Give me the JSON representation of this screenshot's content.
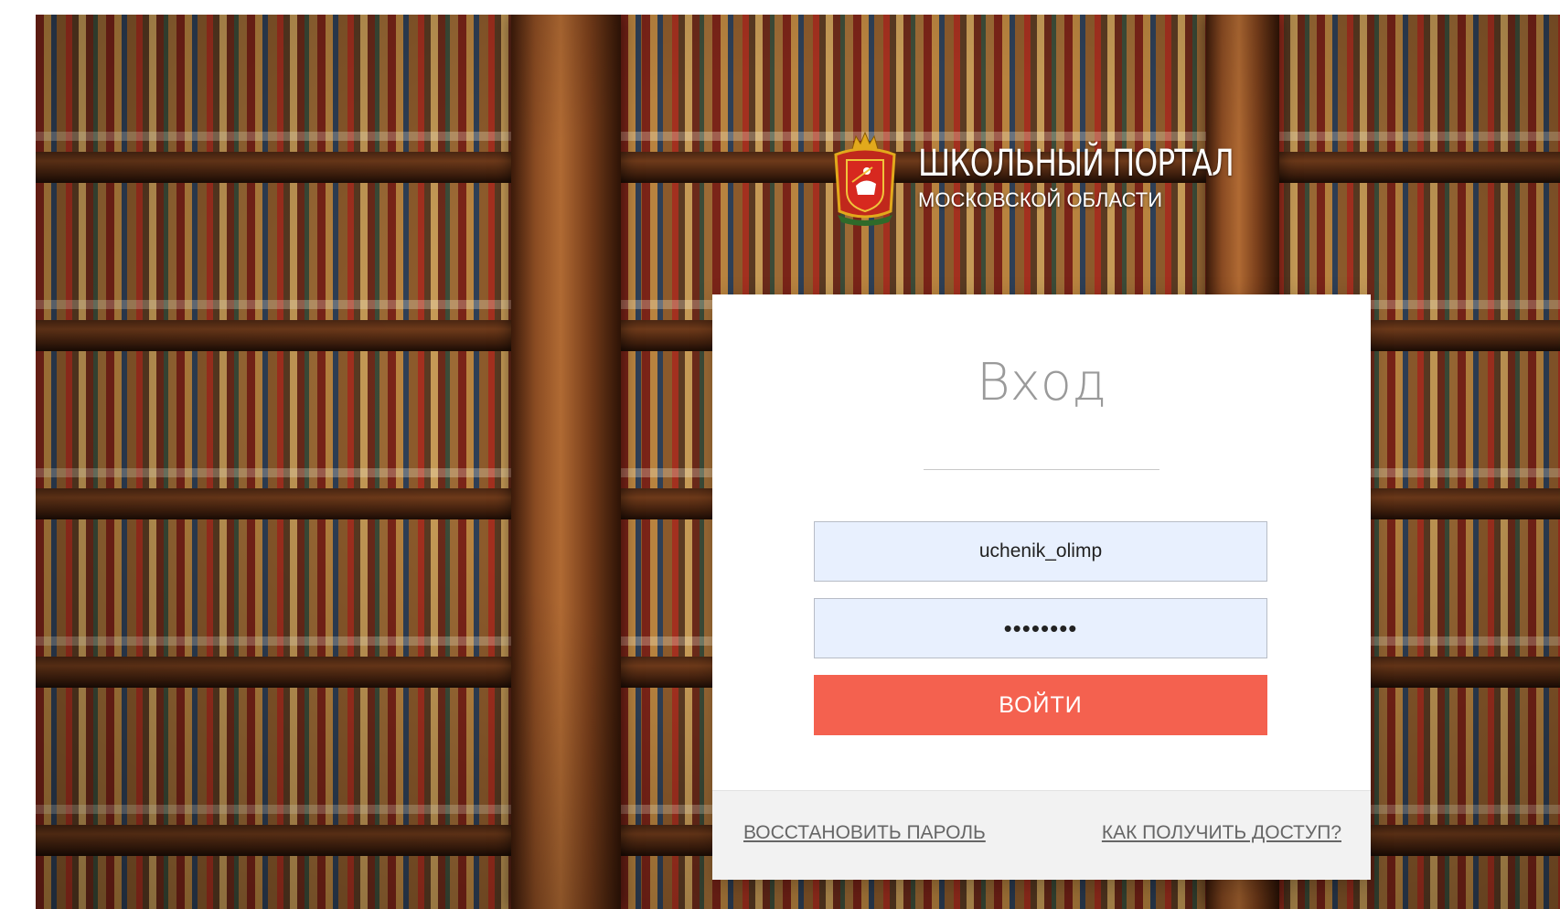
{
  "header": {
    "title": "ШКОЛЬНЫЙ ПОРТАЛ",
    "subtitle": "МОСКОВСКОЙ ОБЛАСТИ",
    "logo_icon": "moscow-oblast-coat-of-arms"
  },
  "login": {
    "heading": "Вход",
    "username_value": "uchenik_olimp",
    "password_value": "••••••••",
    "submit_label": "ВОЙТИ",
    "recover_link": "ВОССТАНОВИТЬ ПАРОЛЬ",
    "access_link": "КАК ПОЛУЧИТЬ ДОСТУП?"
  },
  "colors": {
    "accent": "#f4614f",
    "input_bg": "#e8f0fe",
    "footer_bg": "#f2f2f2"
  }
}
